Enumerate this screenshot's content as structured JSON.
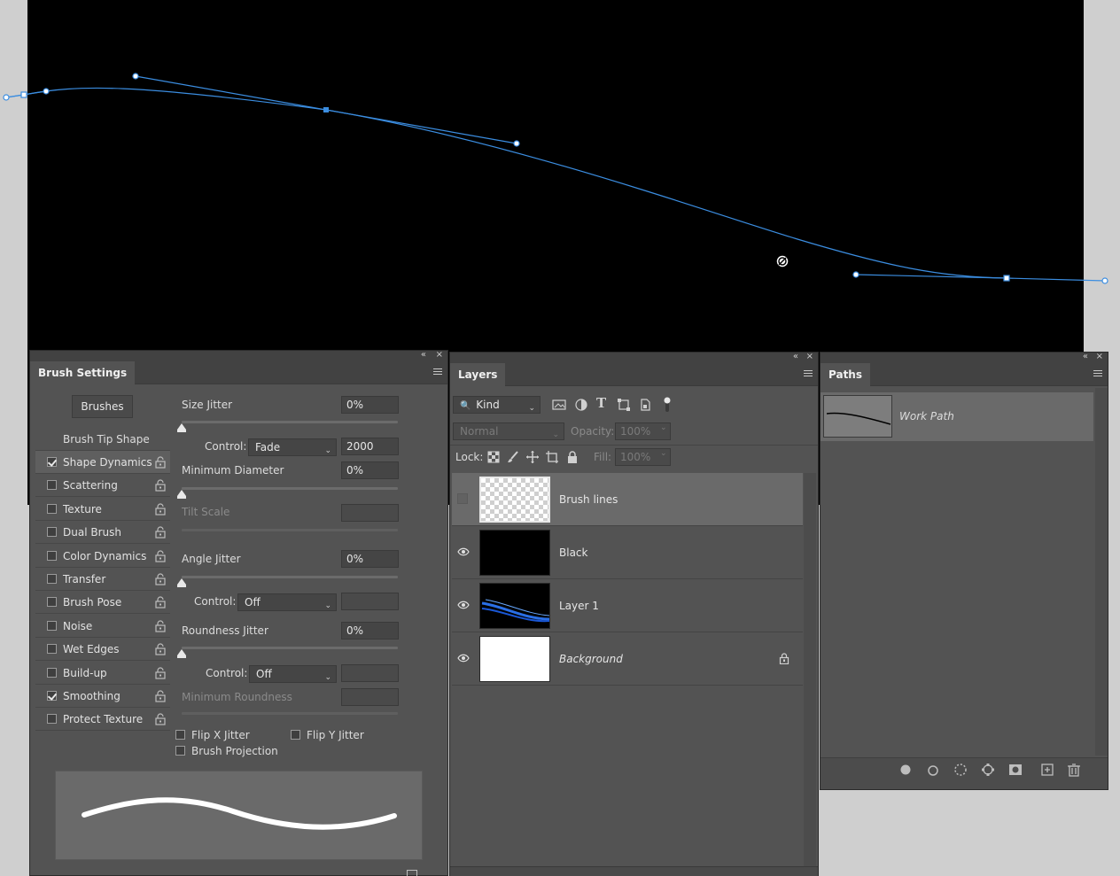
{
  "brush_settings": {
    "tab_label": "Brush Settings",
    "brushes_button": "Brushes",
    "tip_shape_header": "Brush Tip Shape",
    "items": [
      {
        "label": "Shape Dynamics",
        "checked": true,
        "selected": true
      },
      {
        "label": "Scattering",
        "checked": false
      },
      {
        "label": "Texture",
        "checked": false
      },
      {
        "label": "Dual Brush",
        "checked": false
      },
      {
        "label": "Color Dynamics",
        "checked": false
      },
      {
        "label": "Transfer",
        "checked": false
      },
      {
        "label": "Brush Pose",
        "checked": false
      },
      {
        "label": "Noise",
        "checked": false
      },
      {
        "label": "Wet Edges",
        "checked": false
      },
      {
        "label": "Build-up",
        "checked": false
      },
      {
        "label": "Smoothing",
        "checked": true
      },
      {
        "label": "Protect Texture",
        "checked": false
      }
    ],
    "size_jitter_label": "Size Jitter",
    "size_jitter_value": "0%",
    "control_label": "Control:",
    "size_control_value": "Fade",
    "size_control_steps": "2000",
    "min_diameter_label": "Minimum Diameter",
    "min_diameter_value": "0%",
    "tilt_scale_label": "Tilt Scale",
    "angle_jitter_label": "Angle Jitter",
    "angle_jitter_value": "0%",
    "angle_control_value": "Off",
    "roundness_jitter_label": "Roundness Jitter",
    "roundness_jitter_value": "0%",
    "roundness_control_value": "Off",
    "min_roundness_label": "Minimum Roundness",
    "flip_x_label": "Flip X Jitter",
    "flip_y_label": "Flip Y Jitter",
    "brush_projection_label": "Brush Projection"
  },
  "layers": {
    "tab_label": "Layers",
    "filter_kind": "Kind",
    "blend_mode": "Normal",
    "opacity_label": "Opacity:",
    "opacity_value": "100%",
    "lock_label": "Lock:",
    "fill_label": "Fill:",
    "fill_value": "100%",
    "rows": [
      {
        "name": "Brush lines",
        "visible": false,
        "selected": true
      },
      {
        "name": "Black",
        "visible": true
      },
      {
        "name": "Layer 1",
        "visible": true
      },
      {
        "name": "Background",
        "visible": true,
        "locked": true
      }
    ]
  },
  "paths": {
    "tab_label": "Paths",
    "items": [
      {
        "name": "Work Path"
      }
    ]
  },
  "colors": {
    "path_stroke": "#3b8de0",
    "panel_bg": "#535353",
    "canvas_bg": "#000000"
  }
}
